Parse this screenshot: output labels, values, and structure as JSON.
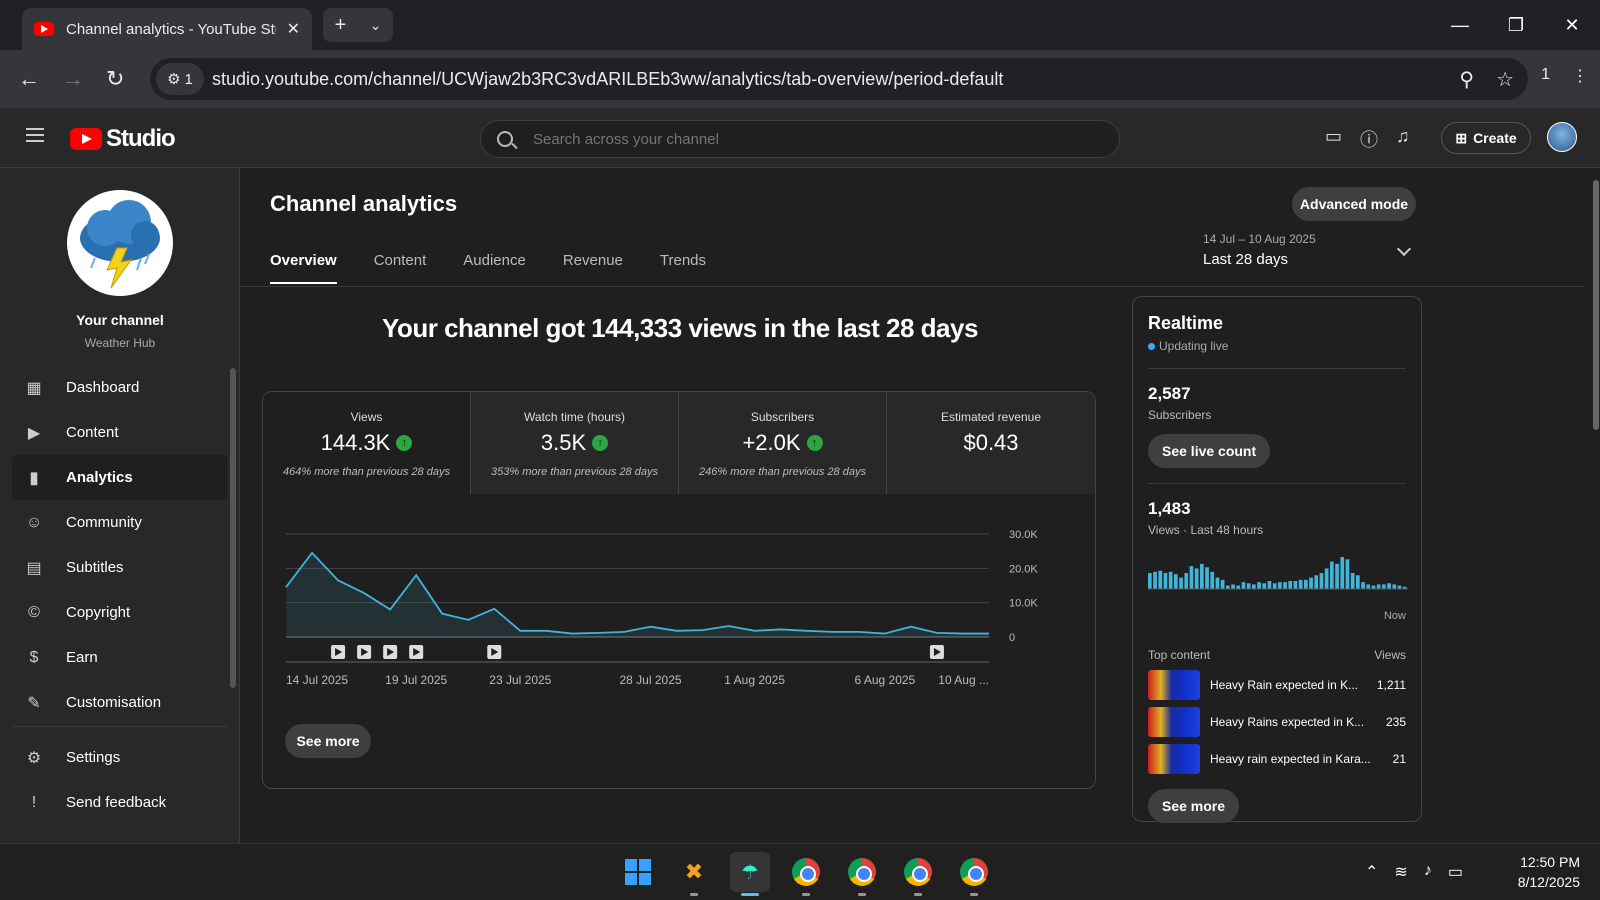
{
  "browser": {
    "tab_title": "Channel analytics - YouTube Studio",
    "url": "studio.youtube.com/channel/UCWjaw2b3RC3vdARILBEb3ww/analytics/tab-overview/period-default",
    "site_chip": "1",
    "profile_count": "1"
  },
  "header": {
    "logo_text": "Studio",
    "search_placeholder": "Search across your channel",
    "create_label": "Create"
  },
  "sidebar": {
    "channel_title": "Your channel",
    "channel_name": "Weather Hub",
    "items": [
      {
        "label": "Dashboard",
        "icon": "dashboard-icon",
        "glyph": "▦"
      },
      {
        "label": "Content",
        "icon": "content-icon",
        "glyph": "▶"
      },
      {
        "label": "Analytics",
        "icon": "analytics-icon",
        "glyph": "▮",
        "active": true
      },
      {
        "label": "Community",
        "icon": "community-icon",
        "glyph": "☺"
      },
      {
        "label": "Subtitles",
        "icon": "subtitles-icon",
        "glyph": "▤"
      },
      {
        "label": "Copyright",
        "icon": "copyright-icon",
        "glyph": "©"
      },
      {
        "label": "Earn",
        "icon": "earn-icon",
        "glyph": "$"
      },
      {
        "label": "Customisation",
        "icon": "customisation-icon",
        "glyph": "✎"
      }
    ],
    "bottom_items": [
      {
        "label": "Settings",
        "icon": "settings-icon",
        "glyph": "⚙"
      },
      {
        "label": "Send feedback",
        "icon": "feedback-icon",
        "glyph": "!"
      }
    ]
  },
  "main": {
    "page_title": "Channel analytics",
    "advanced_mode": "Advanced mode",
    "tabs": [
      "Overview",
      "Content",
      "Audience",
      "Revenue",
      "Trends"
    ],
    "date_range": "14 Jul – 10 Aug 2025",
    "period": "Last 28 days",
    "headline": "Your channel got 144,333 views in the last 28 days",
    "metrics": [
      {
        "label": "Views",
        "value": "144.3K",
        "up": true,
        "comparison": "464% more than previous 28 days"
      },
      {
        "label": "Watch time (hours)",
        "value": "3.5K",
        "up": true,
        "comparison": "353% more than previous 28 days"
      },
      {
        "label": "Subscribers",
        "value": "+2.0K",
        "up": true,
        "comparison": "246% more than previous 28 days"
      },
      {
        "label": "Estimated revenue",
        "value": "$0.43",
        "up": false,
        "comparison": ""
      }
    ],
    "see_more": "See more"
  },
  "chart_data": {
    "type": "area",
    "x": [
      "14 Jul 2025",
      "15 Jul",
      "16 Jul",
      "17 Jul",
      "18 Jul",
      "19 Jul 2025",
      "20 Jul",
      "21 Jul",
      "22 Jul",
      "23 Jul 2025",
      "24 Jul",
      "25 Jul",
      "26 Jul",
      "27 Jul",
      "28 Jul 2025",
      "29 Jul",
      "30 Jul",
      "31 Jul",
      "1 Aug 2025",
      "2 Aug",
      "3 Aug",
      "4 Aug",
      "5 Aug",
      "6 Aug 2025",
      "7 Aug",
      "8 Aug",
      "9 Aug",
      "10 Aug 2025"
    ],
    "values": [
      14500,
      24500,
      16500,
      12800,
      8000,
      18000,
      6800,
      5000,
      8200,
      1800,
      1800,
      1000,
      1200,
      1500,
      3000,
      1800,
      2000,
      3200,
      1800,
      2200,
      1800,
      1500,
      1500,
      1000,
      3000,
      1200,
      1000,
      1000
    ],
    "x_tick_labels": [
      "14 Jul 2025",
      "19 Jul 2025",
      "23 Jul 2025",
      "28 Jul 2025",
      "1 Aug 2025",
      "6 Aug 2025",
      "10 Aug ..."
    ],
    "x_tick_index": [
      0,
      5,
      9,
      14,
      18,
      23,
      27
    ],
    "y_ticks": [
      "0",
      "10.0K",
      "20.0K",
      "30.0K"
    ],
    "y_tick_values": [
      0,
      10000,
      20000,
      30000
    ],
    "ylim": [
      0,
      30000
    ],
    "video_markers": [
      2,
      3,
      4,
      5,
      8,
      25
    ],
    "color": "#41b4d9"
  },
  "realtime": {
    "title": "Realtime",
    "status": "Updating live",
    "subscribers": "2,587",
    "subscribers_label": "Subscribers",
    "live_count_btn": "See live count",
    "views": "1,483",
    "views_label": "Views · Last 48 hours",
    "now_label": "Now",
    "hourly": [
      14,
      15,
      16,
      14,
      15,
      13,
      10,
      14,
      20,
      18,
      22,
      19,
      15,
      10,
      8,
      3,
      4,
      3,
      6,
      5,
      4,
      6,
      5,
      7,
      5,
      6,
      6,
      7,
      7,
      8,
      8,
      10,
      12,
      14,
      18,
      24,
      22,
      28,
      26,
      14,
      12,
      6,
      4,
      3,
      4,
      4,
      5,
      4,
      3,
      2
    ],
    "top_content_label": "Top content",
    "views_col": "Views",
    "top_content": [
      {
        "title": "Heavy Rain expected in K...",
        "views": "1,211"
      },
      {
        "title": "Heavy Rains expected in K...",
        "views": "235"
      },
      {
        "title": "Heavy rain expected in Kara...",
        "views": "21"
      }
    ],
    "see_more": "See more"
  },
  "taskbar": {
    "time": "12:50 PM",
    "date": "8/12/2025"
  }
}
